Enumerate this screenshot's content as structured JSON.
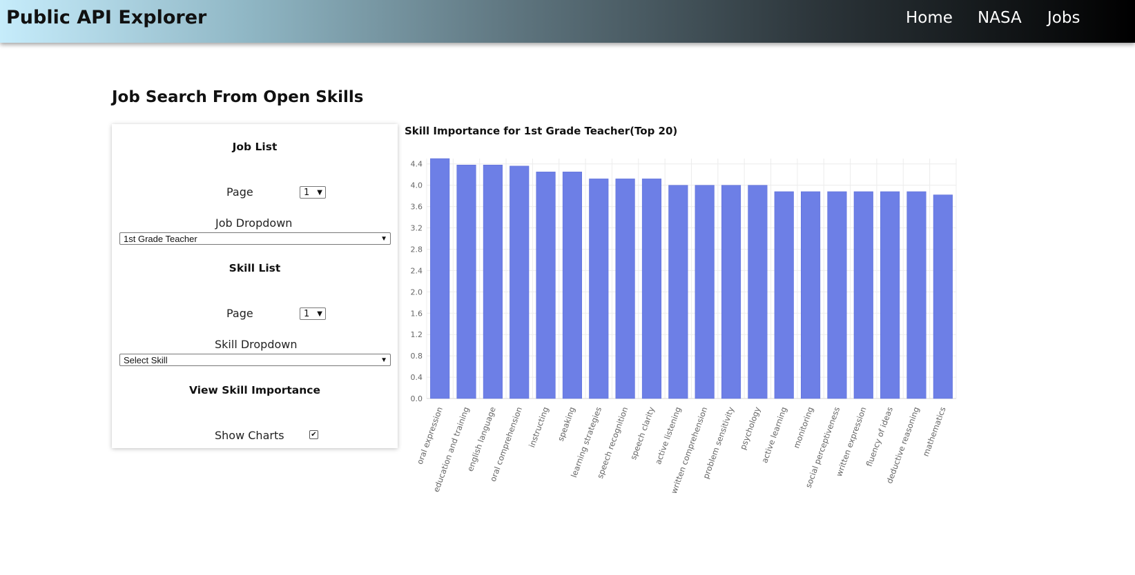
{
  "navbar": {
    "brand": "Public API Explorer",
    "links": [
      {
        "label": "Home"
      },
      {
        "label": "NASA"
      },
      {
        "label": "Jobs"
      }
    ]
  },
  "page": {
    "title": "Job Search From Open Skills"
  },
  "panel": {
    "job_list": {
      "title": "Job List",
      "page_label": "Page",
      "page_value": "1",
      "dropdown_label": "Job Dropdown",
      "dropdown_value": "1st Grade Teacher"
    },
    "skill_list": {
      "title": "Skill List",
      "page_label": "Page",
      "page_value": "1",
      "dropdown_label": "Skill Dropdown",
      "dropdown_value": "Select Skill"
    },
    "view_skill": {
      "title": "View Skill Importance",
      "show_charts_label": "Show Charts",
      "show_charts_checked": true
    }
  },
  "colors": {
    "bar": "#6d7fe6",
    "grid": "#ececec",
    "axis_text": "#666666"
  },
  "chart_data": {
    "type": "bar",
    "title": "Skill Importance for 1st Grade Teacher(Top 20)",
    "xlabel": "",
    "ylabel": "",
    "ylim": [
      0,
      4.5
    ],
    "yticks": [
      "0.0",
      "0.4",
      "0.8",
      "1.2",
      "1.6",
      "2.0",
      "2.4",
      "2.8",
      "3.2",
      "3.6",
      "4.0",
      "4.4"
    ],
    "grid": true,
    "categories": [
      "oral expression",
      "education and training",
      "english language",
      "oral comprehension",
      "instructing",
      "speaking",
      "learning strategies",
      "speech recognition",
      "speech clarity",
      "active listening",
      "written comprehension",
      "problem sensitivity",
      "psychology",
      "active learning",
      "monitoring",
      "social perceptiveness",
      "written expression",
      "fluency of ideas",
      "deductive reasoning",
      "mathematics"
    ],
    "values": [
      4.5,
      4.38,
      4.38,
      4.36,
      4.25,
      4.25,
      4.12,
      4.12,
      4.12,
      4.0,
      4.0,
      4.0,
      4.0,
      3.88,
      3.88,
      3.88,
      3.88,
      3.88,
      3.88,
      3.82
    ]
  }
}
